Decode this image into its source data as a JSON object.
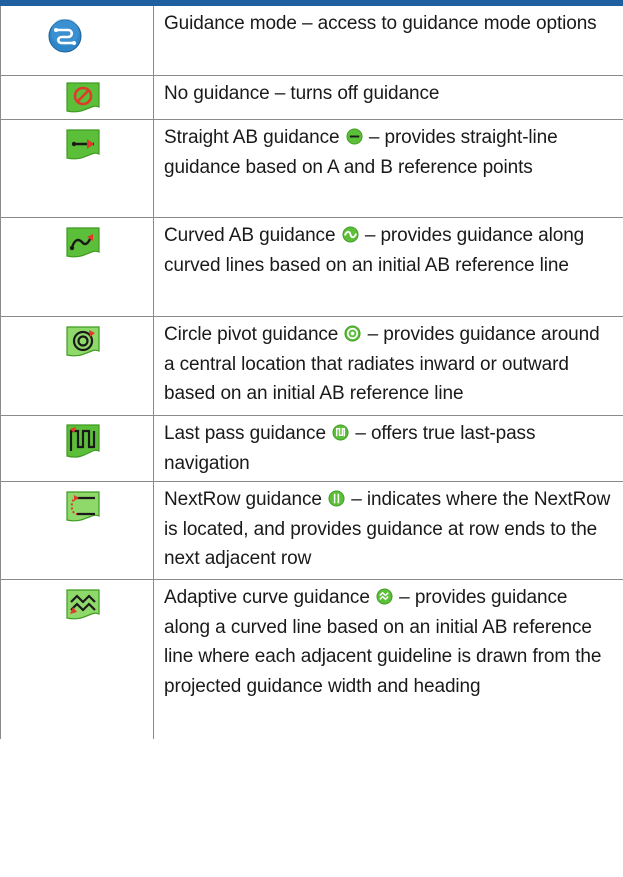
{
  "rows": [
    {
      "text": "Guidance mode – access to guidance mode options",
      "icon": "guidance-mode-icon"
    },
    {
      "text": "No guidance – turns off guidance",
      "icon": "no-guidance-icon"
    },
    {
      "before": "Straight AB guidance",
      "after": "– provides straight-line guidance based on A and B reference points",
      "icon": "straight-ab-icon",
      "inline_icon": "straight-ab-status-icon"
    },
    {
      "before": "Curved AB guidance",
      "after": "– provides guidance along curved lines based on an initial AB reference line",
      "icon": "curved-ab-icon",
      "inline_icon": "curved-ab-status-icon"
    },
    {
      "before": "Circle pivot guidance",
      "after": "– provides guidance around a central location that radiates inward or outward based on an initial AB reference line",
      "icon": "circle-pivot-icon",
      "inline_icon": "circle-pivot-status-icon"
    },
    {
      "before": "Last pass guidance",
      "after": "– offers true last-pass navigation",
      "icon": "last-pass-icon",
      "inline_icon": "last-pass-status-icon"
    },
    {
      "before": "NextRow guidance",
      "after": "– indicates where the NextRow is located, and provides guidance at row ends to the next adjacent row",
      "icon": "nextrow-icon",
      "inline_icon": "nextrow-status-icon"
    },
    {
      "before": "Adaptive curve guidance",
      "after": "– provides guidance along a curved line based on an initial AB reference line where each adjacent guideline is drawn from the projected guidance width and heading",
      "icon": "adaptive-curve-icon",
      "inline_icon": "adaptive-curve-status-icon"
    }
  ],
  "colors": {
    "header_bar": "#1f5fa0",
    "blue_icon": "#2e86c8",
    "green_icon": "#5cbf3a",
    "green_icon_light": "#8fd96a",
    "accent_red": "#e03a2a"
  }
}
